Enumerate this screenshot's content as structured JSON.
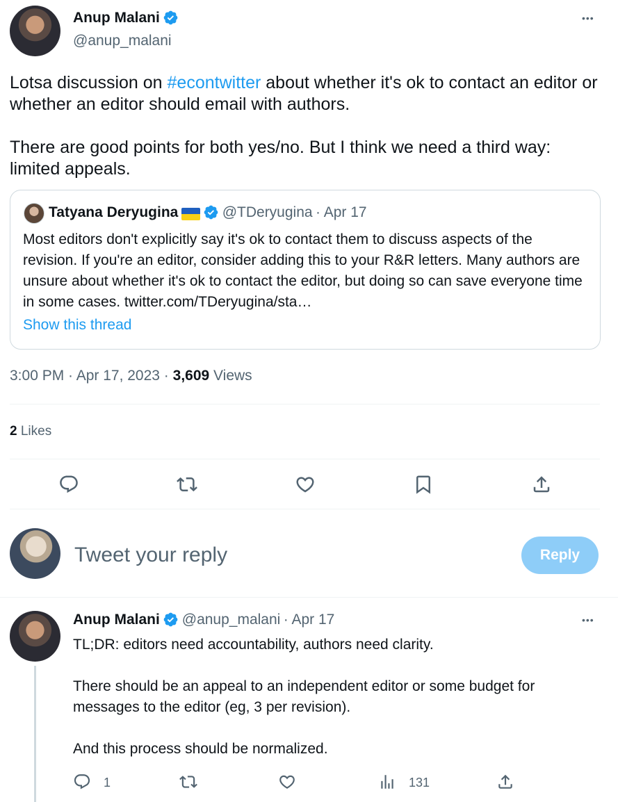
{
  "main_tweet": {
    "author_name": "Anup Malani",
    "author_handle": "@anup_malani",
    "more_label": "•••",
    "text_part1": "Lotsa discussion on ",
    "hashtag": "#econtwitter",
    "text_part2": " about whether it's ok to contact an editor or whether an editor should email with authors.",
    "text_para2": "There are good points for both yes/no. But I think we need a third way: limited appeals.",
    "quoted": {
      "author_name": "Tatyana Deryugina",
      "author_handle": "@TDeryugina",
      "date": "· Apr 17",
      "text": "Most editors don't explicitly say it's ok to contact them to discuss aspects of the revision. If you're an editor, consider adding this to your R&R letters. Many authors are unsure about whether it's ok to contact the editor, but doing so can save everyone time in some cases. twitter.com/TDeryugina/sta…",
      "show_thread": "Show this thread"
    },
    "timestamp": "3:00 PM · Apr 17, 2023 · ",
    "views_count": "3,609",
    "views_label": " Views",
    "likes_count": "2",
    "likes_label": " Likes"
  },
  "reply_composer": {
    "placeholder": "Tweet your reply",
    "button_label": "Reply"
  },
  "thread_reply": {
    "author_name": "Anup Malani",
    "author_handle": "@anup_malani",
    "date": "· Apr 17",
    "more_label": "•••",
    "para1": "TL;DR: editors need accountability, authors need clarity.",
    "para2": "There should be an appeal to an independent editor or some budget for messages to the editor (eg, 3 per revision).",
    "para3": "And this process should be normalized.",
    "reply_count": "1",
    "views_count": "131"
  },
  "colors": {
    "accent": "#1d9bf0",
    "muted": "#536471",
    "reply_button": "#8ecdf8"
  }
}
